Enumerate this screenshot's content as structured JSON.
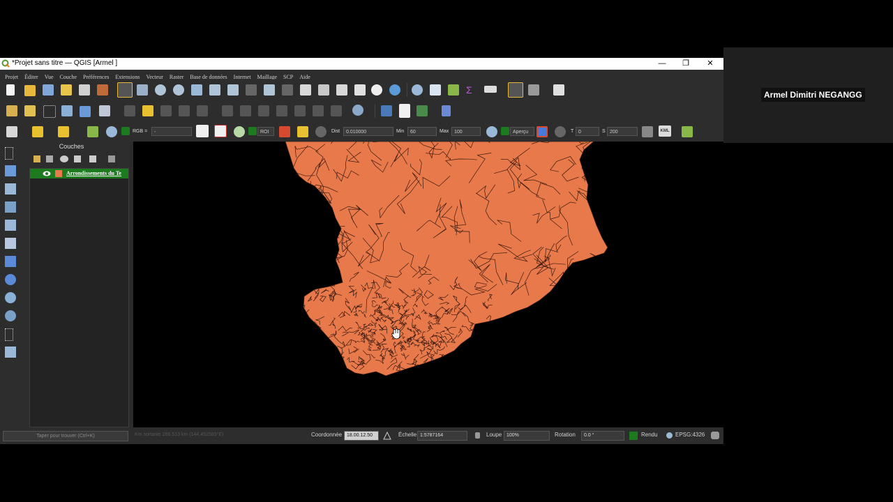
{
  "presenter_name": "Armel Dimitri NEGANGG",
  "window": {
    "title": "*Projet sans titre — QGIS [Armel ]",
    "controls": {
      "minimize": "—",
      "restore": "❐",
      "close": "✕"
    }
  },
  "menu": [
    "Projet",
    "Éditer",
    "Vue",
    "Couche",
    "Préférences",
    "Extensions",
    "Vecteur",
    "Raster",
    "Base de données",
    "Internet",
    "Maillage",
    "SCP",
    "Aide"
  ],
  "toolbar3": {
    "rgb_label": "RGB =",
    "rgb_value": "-",
    "roi_label": "ROI",
    "dist_label": "Dist",
    "dist_value": "0.010000",
    "min_label": "Min",
    "min_value": "60",
    "max_label": "Max",
    "max_value": "100",
    "apercu_label": "Aperçu",
    "t_label": "T",
    "t_value": "0",
    "s_label": "S",
    "s_value": "200",
    "kml_label": "KML"
  },
  "layers_panel": {
    "title": "Couches",
    "layer_name": "Arrondissements du Te",
    "layer_color": "#e8794a"
  },
  "map": {
    "fill_color": "#e8794a",
    "stroke_color": "#3a1a10"
  },
  "statusbar": {
    "locator_placeholder": "Taper pour trouver (Ctrl+K)",
    "measure_text": "Km sortante 266.513 km (144.452583°E)",
    "coord_label": "Coordonnée",
    "coord_value": "18.00.12.50",
    "scale_label": "Échelle",
    "scale_value": "1:5787164",
    "magnifier_label": "Loupe",
    "magnifier_value": "100%",
    "rotation_label": "Rotation",
    "rotation_value": "0.0 °",
    "render_label": "Rendu",
    "crs_label": "EPSG:4326"
  }
}
